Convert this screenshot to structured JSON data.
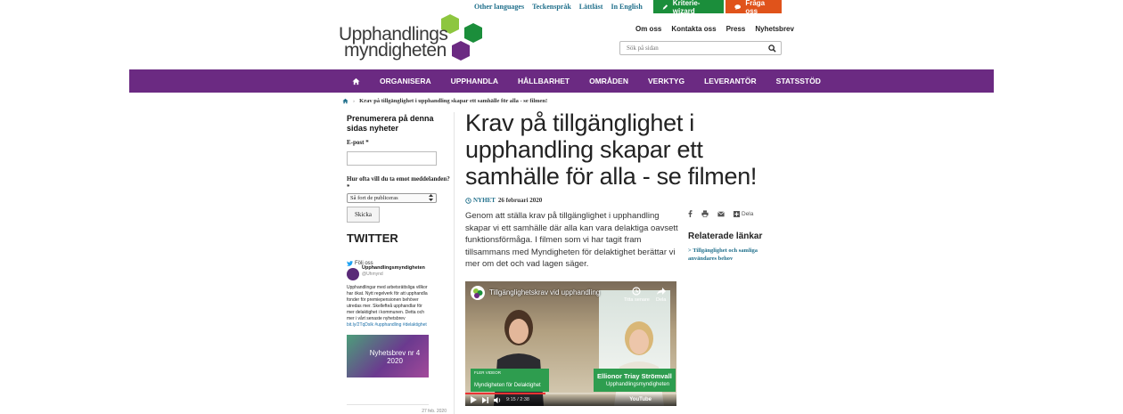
{
  "utility": {
    "other_languages": "Other languages",
    "sign_language": "Teckenspråk",
    "easy_read": "Lättläst",
    "english": "In English",
    "wizard_label": "Kriterie-wizard",
    "ask_label": "Fråga oss"
  },
  "logo": {
    "line1": "Upphandlings",
    "line2": "myndigheten"
  },
  "secnav": {
    "about": "Om oss",
    "contact": "Kontakta oss",
    "press": "Press",
    "newsletter": "Nyhetsbrev"
  },
  "search": {
    "placeholder": "Sök på sidan"
  },
  "mainnav": [
    "ORGANISERA",
    "UPPHANDLA",
    "HÅLLBARHET",
    "OMRÅDEN",
    "VERKTYG",
    "LEVERANTÖR",
    "STATSSTÖD"
  ],
  "breadcrumb": {
    "current": "Krav på tillgänglighet i upphandling skapar ett samhälle för alla - se filmen!"
  },
  "subscribe": {
    "title": "Prenumerera på denna sidas nyheter",
    "email_label": "E-post *",
    "freq_label": "Hur ofta vill du ta emot meddelanden? *",
    "freq_value": "Så fort de publiceras",
    "submit": "Skicka"
  },
  "twitter": {
    "heading": "TWITTER",
    "follow": "Följ oss",
    "name": "Upphandlingsmyndigheten",
    "handle": "@Uhmynd",
    "text": "Upphandlingar med arbetsrättsliga villkor har ökat. Nytt regelverk för att upphandla fonder för premiepensionen behöver utredas mer. Skellefteå upphandlar för mer delaktighet i kommunen. Detta och mer i vårt senaste nyhetsbrev",
    "links": "bit.ly/2TqDslk #upphandling #delaktighet",
    "image_title": "Nyhetsbrev nr 4 2020",
    "date": "27 feb. 2020"
  },
  "article": {
    "title": "Krav på tillgänglighet i upphandling skapar ett samhälle för alla - se filmen!",
    "tag": "NYHET",
    "date": "26 februari 2020",
    "lead": "Genom att ställa krav på tillgänglighet i upphandling skapar vi ett samhälle där alla kan vara delaktiga oavsett funktionsförmåga. I filmen som vi har tagit fram tillsammans med Myndigheten för delaktighet berättar vi mer om det och vad lagen säger."
  },
  "video": {
    "title": "Tillgänglighetskrav vid upphandling",
    "watch_later": "Titta senare",
    "share": "Dela",
    "cap1_small": "FLER VIDEOR",
    "cap1_org": "Myndigheten för Delaktighet",
    "cap2_name": "Ellionor Triay Strömvall",
    "cap2_org": "Upphandlingsmyndigheten",
    "time": "9:15 / 2:38",
    "youtube": "YouTube",
    "progress": 0.38
  },
  "sidebar": {
    "share": "Dela",
    "related_title": "Relaterade länkar",
    "related_link": "Tillgänglighet och samliga användares behov"
  },
  "colors": {
    "purple": "#6b2a82",
    "green": "#1b8e3b",
    "orange": "#e0531b",
    "link": "#1f6f8b"
  }
}
